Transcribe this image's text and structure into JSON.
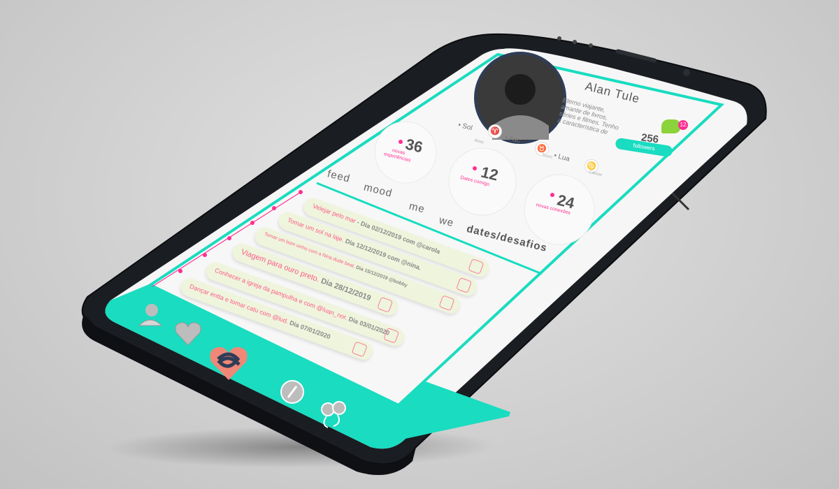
{
  "profile": {
    "name": "Alan Tule",
    "bio": "Eterno viajante, amante de livros, séries e filmes. Tenho a característica de",
    "followers_count": "256",
    "followers_label": "followers",
    "messages_badge": "12"
  },
  "astro": {
    "sol_label": "• Sol",
    "sol_sign": "Áries",
    "asc_label": "• Asc",
    "asc_sign": "Touro",
    "lua_label": "• Lua",
    "lua_sign": "Câncer"
  },
  "stats": [
    {
      "value": "36",
      "label": "novas experiências"
    },
    {
      "value": "12",
      "label": "Dates comigo"
    },
    {
      "value": "24",
      "label": "novas conexões"
    }
  ],
  "tabs": [
    "feed",
    "mood",
    "me",
    "we",
    "dates/desafios"
  ],
  "active_tab": "dates/desafios",
  "feed": [
    {
      "text": "Velejar pelo mar",
      "detail": " - Dia 02/12/2019 com @carola"
    },
    {
      "text": "Tomar um sol na laje.",
      "detail": " Dia 12/12/2019 com @nina."
    },
    {
      "text": "Tomar um bom vinho com a Nina dude beat.",
      "detail": " Dia 15/12/2019 @bobby"
    },
    {
      "text": "Viagem para ouro preto.",
      "detail": " Dia 28/12/2019"
    },
    {
      "text": "Conhecer a igreja da pampulha e com @luan_nor.",
      "detail": " Dia 03/01/2020"
    },
    {
      "text": "Dançar entta e tomar catu com @lud.",
      "detail": " Dia 07/01/2020"
    }
  ],
  "colors": {
    "accent": "#19dcc0",
    "pink": "#ff2f92",
    "feed_bg": "#eef5dc",
    "nav_active": "#f08878"
  },
  "nav_icons": [
    "profile-icon",
    "mood-icon",
    "dates-knot-icon",
    "explore-icon",
    "connections-icon"
  ]
}
